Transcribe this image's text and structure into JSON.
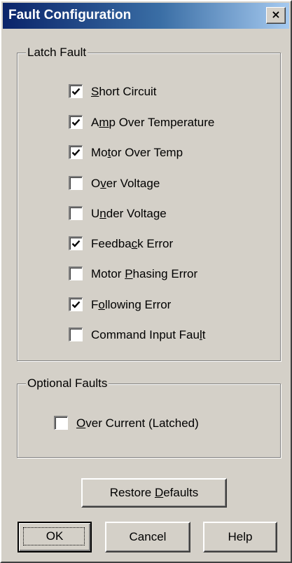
{
  "window": {
    "title": "Fault Configuration",
    "close_label": "×"
  },
  "latch_group": {
    "label": "Latch Fault",
    "items": [
      {
        "pre": "",
        "mn": "S",
        "post": "hort Circuit",
        "checked": true
      },
      {
        "pre": "A",
        "mn": "m",
        "post": "p Over Temperature",
        "checked": true
      },
      {
        "pre": "Mo",
        "mn": "t",
        "post": "or Over Temp",
        "checked": true
      },
      {
        "pre": "O",
        "mn": "v",
        "post": "er Voltage",
        "checked": false
      },
      {
        "pre": "U",
        "mn": "n",
        "post": "der Voltage",
        "checked": false
      },
      {
        "pre": "Feedba",
        "mn": "c",
        "post": "k Error",
        "checked": true
      },
      {
        "pre": "Motor ",
        "mn": "P",
        "post": "hasing Error",
        "checked": false
      },
      {
        "pre": "F",
        "mn": "o",
        "post": "llowing Error",
        "checked": true
      },
      {
        "pre": "Command Input Fau",
        "mn": "l",
        "post": "t",
        "checked": false
      }
    ]
  },
  "optional_group": {
    "label": "Optional Faults",
    "items": [
      {
        "pre": "",
        "mn": "O",
        "post": "ver Current (Latched)",
        "checked": false
      }
    ]
  },
  "buttons": {
    "restore": {
      "pre": "Restore ",
      "mn": "D",
      "post": "efaults"
    },
    "ok": {
      "pre": "",
      "mn": "",
      "post": "OK"
    },
    "cancel": {
      "pre": "",
      "mn": "",
      "post": "Cancel"
    },
    "help": {
      "pre": "",
      "mn": "",
      "post": "Help"
    }
  },
  "colors": {
    "dialog_face": "#d4d0c8",
    "title_start": "#0a246a",
    "title_end": "#a6caf0"
  },
  "icons": {
    "check": "check-mark-icon",
    "close": "close-icon"
  }
}
